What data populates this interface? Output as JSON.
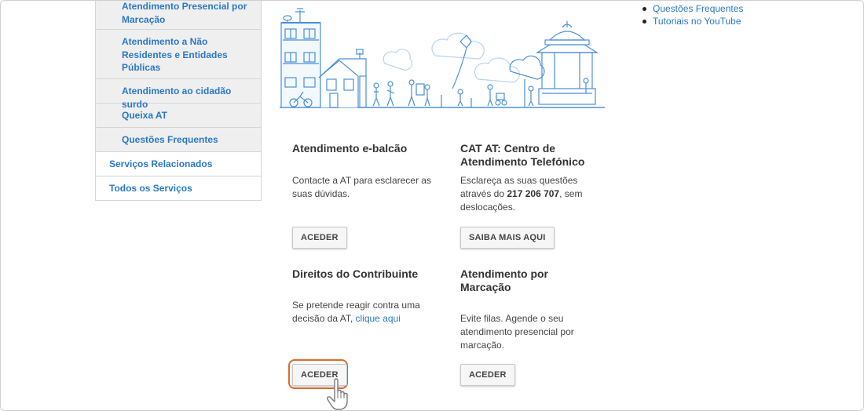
{
  "sidebar": {
    "items": [
      {
        "label": "Atendimento Presencial por Marcação"
      },
      {
        "label": "Atendimento a Não Residentes e Entidades Públicas"
      },
      {
        "label": "Atendimento ao cidadão surdo"
      },
      {
        "label": "Queixa AT"
      },
      {
        "label": "Questões Frequentes"
      },
      {
        "label": "Serviços Relacionados"
      },
      {
        "label": "Todos os Serviços"
      }
    ]
  },
  "cards": [
    {
      "title": "Atendimento e-balcão",
      "desc": "Contacte a AT para esclarecer as suas dúvidas.",
      "button": "ACEDER"
    },
    {
      "title": "CAT AT: Centro de Atendimento Telefónico",
      "desc_pre": "Esclareça as suas questões através do ",
      "phone": "217 206 707",
      "desc_post": ", sem deslocações.",
      "button": "SAIBA MAIS AQUI"
    },
    {
      "title": "Direitos do Contribuinte",
      "desc": "Se pretende reagir contra uma decisão da AT, ",
      "link": "clique aqui",
      "button": "ACEDER"
    },
    {
      "title": "Atendimento por Marcação",
      "desc": "Evite filas. Agende o seu atendimento presencial por marcação.",
      "button": "ACEDER"
    }
  ],
  "right_links": [
    {
      "label": "Questões Frequentes"
    },
    {
      "label": "Tutoriais no YouTube"
    }
  ],
  "colors": {
    "link": "#2b78c4",
    "highlight": "#e06a2a",
    "illustration": "#4a90d9"
  },
  "icons": {
    "cursor": "hand-pointer-icon"
  }
}
